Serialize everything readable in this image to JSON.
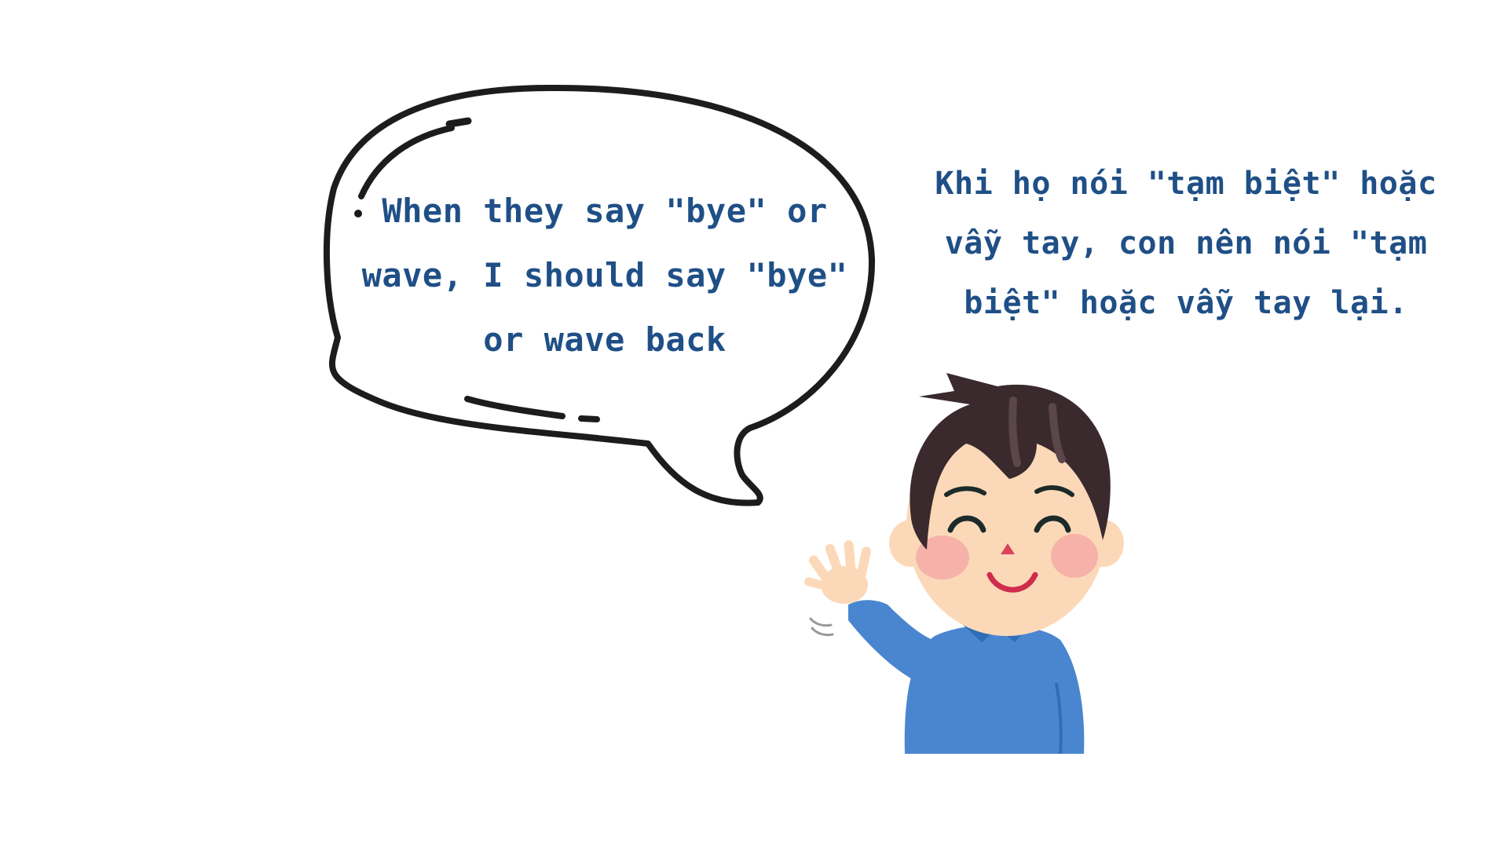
{
  "speech_bubble": {
    "text": "When they say \"bye\" or wave, I should say \"bye\" or wave back"
  },
  "caption": {
    "text": "Khi họ nói \"tạm biệt\" hoặc vẫy tay, con nên nói \"tạm biệt\" hoặc vẫy tay lại."
  },
  "colors": {
    "text": "#1f4f86",
    "bubble_outline": "#1c1c1c",
    "shirt": "#4a86cf",
    "hair": "#3a2a2e",
    "skin": "#fbd9b8",
    "cheek": "#f4a4a4"
  },
  "illustration": {
    "subject": "waving-boy"
  }
}
